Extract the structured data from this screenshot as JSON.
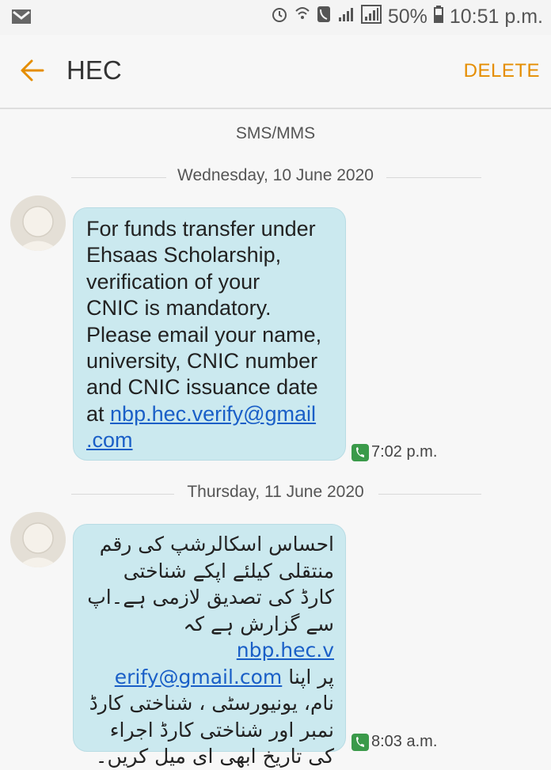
{
  "statusbar": {
    "battery": "50%",
    "time": "10:51 p.m."
  },
  "appbar": {
    "title": "HEC",
    "delete_label": "DELETE"
  },
  "conversation": {
    "channel_label": "SMS/MMS",
    "days": [
      {
        "date": "Wednesday, 10 June 2020",
        "message": {
          "lines": [
            "For funds transfer under",
            "Ehsaas Scholarship,",
            "verification of your",
            "CNIC is mandatory.",
            "Please email your name,",
            "university, CNIC number",
            "and CNIC issuance date"
          ],
          "prefix": "at ",
          "link_part1": "nbp.hec.verify@gmail",
          "link_part2": ".com",
          "time": "7:02 p.m."
        }
      },
      {
        "date": "Thursday, 11 June 2020",
        "message": {
          "lines": [
            "احساس اسکالرشپ کی رقم",
            "منتقلی  کیلئے اپکے شناختی",
            "کارڈ کی تصدیق لازمی ہے۔اپ",
            "سے گزارش ہے کہ",
            "nbp.hec.v",
            "erify@gmail.com",
            "پر اپنا",
            "نام، یونیورسٹی ، شناختی کارڈ",
            "نمبر اور شناختی کارڈ اجراء",
            "کی تاریخ ابھی ای میل  کریں۔"
          ],
          "time": "8:03 a.m."
        }
      }
    ]
  }
}
